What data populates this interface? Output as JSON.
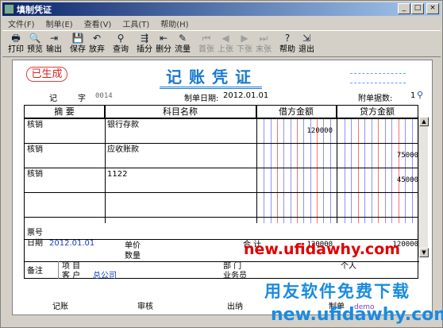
{
  "window": {
    "title": "填制凭证",
    "controls": [
      "_",
      "□",
      "×"
    ]
  },
  "menu": [
    "文件(F)",
    "制单(E)",
    "查看(V)",
    "工具(T)",
    "帮助(H)"
  ],
  "toolbar": [
    {
      "label": "打印",
      "icon": "printer-icon",
      "glyph": "🖶",
      "disabled": false
    },
    {
      "label": "预览",
      "icon": "preview-icon",
      "glyph": "🔍",
      "disabled": false
    },
    {
      "label": "输出",
      "icon": "export-icon",
      "glyph": "⇥",
      "disabled": false
    },
    {
      "label": "保存",
      "icon": "save-icon",
      "glyph": "💾",
      "disabled": false
    },
    {
      "label": "放弃",
      "icon": "undo-icon",
      "glyph": "↶",
      "disabled": false
    },
    {
      "label": "查询",
      "icon": "binoculars-icon",
      "glyph": "⚲",
      "disabled": false
    },
    {
      "label": "插分",
      "icon": "insert-row-icon",
      "glyph": "⇶",
      "disabled": false
    },
    {
      "label": "删分",
      "icon": "delete-row-icon",
      "glyph": "⇤",
      "disabled": false
    },
    {
      "label": "流量",
      "icon": "flow-icon",
      "glyph": "✎",
      "disabled": false
    },
    {
      "label": "首张",
      "icon": "first-icon",
      "glyph": "⏮",
      "disabled": true
    },
    {
      "label": "上张",
      "icon": "prev-icon",
      "glyph": "◀",
      "disabled": true
    },
    {
      "label": "下张",
      "icon": "next-icon",
      "glyph": "▶",
      "disabled": true
    },
    {
      "label": "末张",
      "icon": "last-icon",
      "glyph": "⏭",
      "disabled": true
    },
    {
      "label": "帮助",
      "icon": "help-icon",
      "glyph": "?",
      "disabled": false
    },
    {
      "label": "退出",
      "icon": "exit-icon",
      "glyph": "⇲",
      "disabled": false
    }
  ],
  "voucher": {
    "status_stamp": "已生成",
    "title": "记账凭证",
    "type_label": "记",
    "number_label": "字",
    "number": "0014",
    "date_label": "制单日期:",
    "date": "2012.01.01",
    "attach_label": "附单据数:",
    "attach_count": "1",
    "headers": {
      "summary": "摘 要",
      "account": "科目名称",
      "debit": "借方金额",
      "credit": "贷方金额"
    },
    "rows": [
      {
        "summary": "核销",
        "account": "银行存款",
        "debit": "120000",
        "credit": ""
      },
      {
        "summary": "核销",
        "account": "应收账款",
        "debit": "",
        "credit": "75000"
      },
      {
        "summary": "核销",
        "account": "1122",
        "debit": "",
        "credit": "45000"
      },
      {
        "summary": "",
        "account": "",
        "debit": "",
        "credit": ""
      },
      {
        "summary": "",
        "account": "",
        "debit": "",
        "credit": ""
      }
    ],
    "footer": {
      "bill_no_label": "票号",
      "date_label": "日期",
      "date_value": "2012.01.01",
      "unit_price_label": "单价",
      "quantity_label": "数量",
      "total_label": "合 计",
      "total_debit": "120000",
      "total_credit": "120000",
      "remark_label": "备注",
      "project_label": "项 目",
      "customer_label": "客 户",
      "customer_value": "总公司",
      "dept_label": "部 门",
      "salesperson_label": "业务员",
      "person_label": "个人"
    },
    "signoff": {
      "bookkeeping": "记账",
      "review": "审核",
      "cashier": "出纳",
      "maker": "制单",
      "maker_name": "demo"
    }
  },
  "watermark": {
    "url_top": "new.ufidawhy.com",
    "slogan": "用友软件免费下载",
    "url_bottom": "new.ufidawhy.com"
  },
  "colors": {
    "title_blue": "#1a7ad0",
    "stamp_red": "#e02020",
    "watermark_red": "#e00000",
    "watermark_blue": "#1a8be0"
  }
}
